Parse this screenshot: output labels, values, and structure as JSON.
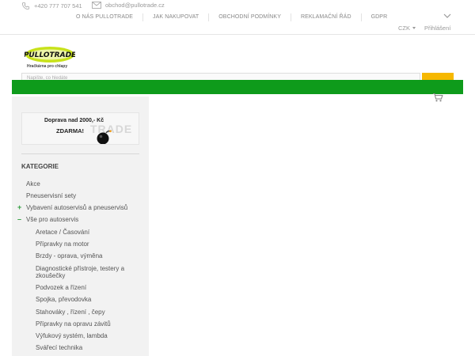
{
  "topbar": {
    "phone": "+420 777 707 541",
    "email": "obchod@pullotrade.cz",
    "nav": [
      "O NÁS PULLOTRADE",
      "JAK NAKUPOVAT",
      "OBCHODNÍ PODMÍNKY",
      "REKLAMAČNÍ ŘÁD",
      "GDPR"
    ],
    "currency": "CZK",
    "login": "Přihlášení"
  },
  "logo": {
    "brand": "PULLOTRADE",
    "tagline": "Hračkárna pro chlapy"
  },
  "search": {
    "placeholder": "Napište, co hledáte"
  },
  "colors": {
    "green_bar": "#0e9b1b",
    "search_button": "#f6b800",
    "sidebar_bg": "#f2f2f2"
  },
  "sidebar": {
    "banner": {
      "line1": "Doprava nad 2000,- Kč",
      "line2": "ZDARMA!",
      "ghost_text": "TRADE"
    },
    "title": "KATEGORIE",
    "items": [
      {
        "label": "Akce",
        "level": 1,
        "sign": ""
      },
      {
        "label": "Pneuservisní sety",
        "level": 1,
        "sign": ""
      },
      {
        "label": "Vybavení autoservisů a pneuservisů",
        "level": 1,
        "sign": "+"
      },
      {
        "label": "Vše pro autoservis",
        "level": 1,
        "sign": "–"
      },
      {
        "label": "Aretace / Časování",
        "level": 2,
        "sign": ""
      },
      {
        "label": "Přípravky na motor",
        "level": 2,
        "sign": ""
      },
      {
        "label": "Brzdy - oprava, výměna",
        "level": 2,
        "sign": ""
      },
      {
        "label": "Diagnostické přístroje, testery a zkoušečky",
        "level": 2,
        "sign": ""
      },
      {
        "label": "Podvozek a řízení",
        "level": 2,
        "sign": ""
      },
      {
        "label": "Spojka, převodovka",
        "level": 2,
        "sign": ""
      },
      {
        "label": "Stahováky , řízení , čepy",
        "level": 2,
        "sign": ""
      },
      {
        "label": "Přípravky na opravu závitů",
        "level": 2,
        "sign": ""
      },
      {
        "label": "Výfukový systém, lambda",
        "level": 2,
        "sign": ""
      },
      {
        "label": "Svářecí technika",
        "level": 2,
        "sign": ""
      }
    ]
  }
}
